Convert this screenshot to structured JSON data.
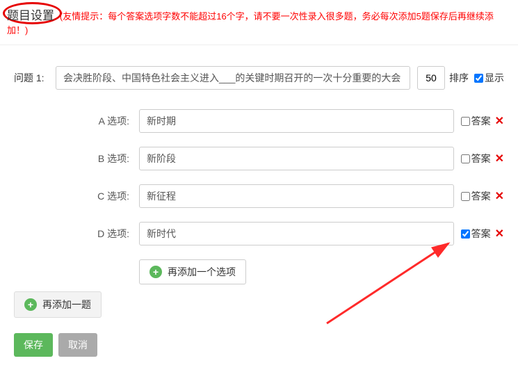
{
  "colors": {
    "danger": "#e60000",
    "success": "#5cb85c",
    "gray": "#aaaaaa"
  },
  "header": {
    "title": "题目设置",
    "hint": "(友情提示：每个答案选项字数不能超过16个字，请不要一次性录入很多题，务必每次添加5题保存后再继续添加！)"
  },
  "question": {
    "label": "问题 1:",
    "text": "会决胜阶段、中国特色社会主义进入___的关键时期召开的一次十分重要的大会",
    "order": "50",
    "order_label": "排序",
    "show_label": "显示",
    "show_checked": true
  },
  "options": [
    {
      "letter": "A",
      "label": "A 选项:",
      "value": "新时期",
      "is_answer": false
    },
    {
      "letter": "B",
      "label": "B 选项:",
      "value": "新阶段",
      "is_answer": false
    },
    {
      "letter": "C",
      "label": "C 选项:",
      "value": "新征程",
      "is_answer": false
    },
    {
      "letter": "D",
      "label": "D 选项:",
      "value": "新时代",
      "is_answer": true
    }
  ],
  "answer_label": "答案",
  "delete_glyph": "✕",
  "add_option_label": "再添加一个选项",
  "add_question_label": "再添加一题",
  "save_label": "保存",
  "cancel_label": "取消"
}
